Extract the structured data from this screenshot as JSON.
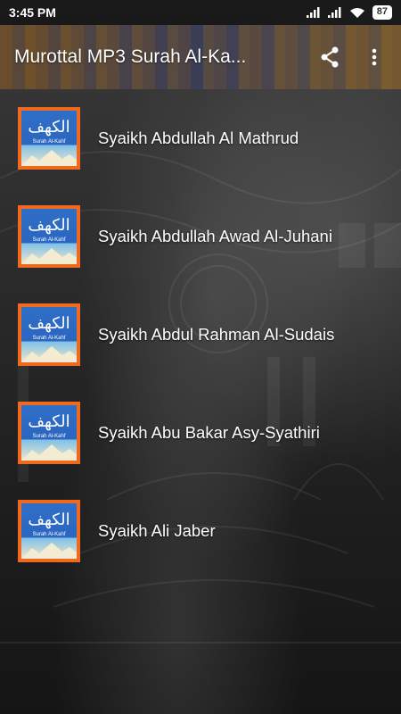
{
  "status_bar": {
    "time": "3:45 PM",
    "battery": "87"
  },
  "app_bar": {
    "title": "Murottal MP3 Surah Al-Ka..."
  },
  "thumbnail": {
    "arabic": "الكهف",
    "caption": "Surah Al-Kahf"
  },
  "list": {
    "items": [
      {
        "label": "Syaikh Abdullah Al Mathrud"
      },
      {
        "label": "Syaikh Abdullah Awad Al-Juhani"
      },
      {
        "label": "Syaikh Abdul Rahman Al-Sudais"
      },
      {
        "label": "Syaikh Abu Bakar Asy-Syathiri"
      },
      {
        "label": "Syaikh Ali Jaber"
      }
    ]
  },
  "colors": {
    "thumb_border": "#ef6a1f",
    "thumb_blue": "#2f6ec7"
  },
  "icons": {
    "share": "share-icon",
    "overflow": "more-vert-icon"
  }
}
